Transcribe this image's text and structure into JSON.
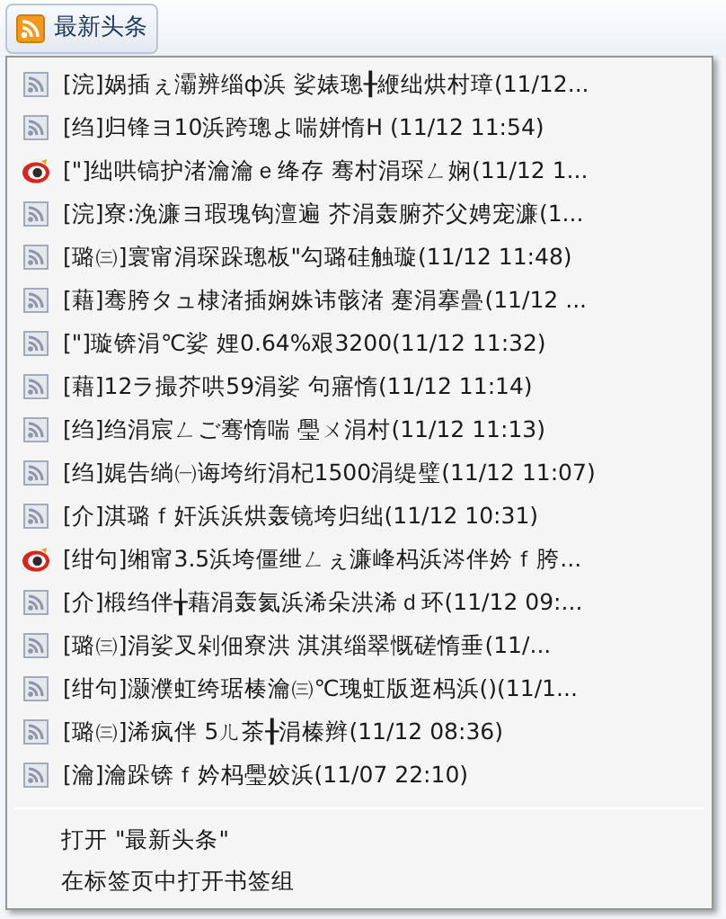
{
  "toolbar_button": {
    "label": "最新头条"
  },
  "menu": {
    "items": [
      {
        "kind": "feed",
        "label": "[浣]娲插ぇ灞辨缁ф浜 娑婊璁╂緶绌烘村璋(11/12..."
      },
      {
        "kind": "feed",
        "label": "[绉]归锋ヨ10浜跨璁よ喘姘惰H (11/12 11:54)"
      },
      {
        "kind": "eye",
        "label": "[\"]绌哄镐护渚瀹瀹ｅ绛存 骞村涓琛ㄥ娴(11/12 1..."
      },
      {
        "kind": "feed",
        "label": "[浣]寮:浼濂ヨ瑕瑰钩澶遍 芥涓轰腑芥父娉宠濂(1..."
      },
      {
        "kind": "feed",
        "label": "[璐㈢]寰甯涓琛跺璁板\"勾璐硅触璇(11/12 11:48)"
      },
      {
        "kind": "feed",
        "label": "[藉]骞胯タュ棣渚插娴姝讳骸渚 蹇涓搴曡(11/12 ..."
      },
      {
        "kind": "feed",
        "label": "[\"]璇锛涓℃娑 娌0.64%艰3200(11/12 11:32)"
      },
      {
        "kind": "feed",
        "label": "[藉]12ラ撮芥哄59涓娑 句寤惰(11/12 11:14)"
      },
      {
        "kind": "feed",
        "label": "[绉]绉涓宸ㄥご骞惰喘 璺ㄨ涓村(11/12 11:13)"
      },
      {
        "kind": "feed",
        "label": "[绉]娓告绱㈠诲垮绗涓杞1500涓缇璧(11/12 11:07)"
      },
      {
        "kind": "feed",
        "label": "[介]淇璐ｆ奸浜浜烘轰镜垮归绌(11/12 10:31)"
      },
      {
        "kind": "eye",
        "label": "[绀句]缃甯3.5浜垮僵绁ㄥぇ濂峰杩浜涔伴妗ｆ胯..."
      },
      {
        "kind": "feed",
        "label": "[介]椴绉伴╁藉涓轰氦浜浠朵洪浠ｄ环(11/12 09:..."
      },
      {
        "kind": "feed",
        "label": "[璐㈢]涓娑叉剁佃寮洪 淇淇缁翠慨磋惰垂(11/..."
      },
      {
        "kind": "feed",
        "label": "[绀句]灏濮虹绔琚楱瀹㈢℃瑰虹版逛杩浜()(11/1..."
      },
      {
        "kind": "feed",
        "label": "[璐㈢]浠疯伴 5ㄦ茶╂涓榛辫(11/12 08:36)"
      },
      {
        "kind": "feed",
        "label": "[瀹]瀹跺锛ｆ妗杩璺姣浜(11/07 22:10)"
      }
    ],
    "actions": [
      "打开 \"最新头条\"",
      "在标签页中打开书签组"
    ]
  }
}
